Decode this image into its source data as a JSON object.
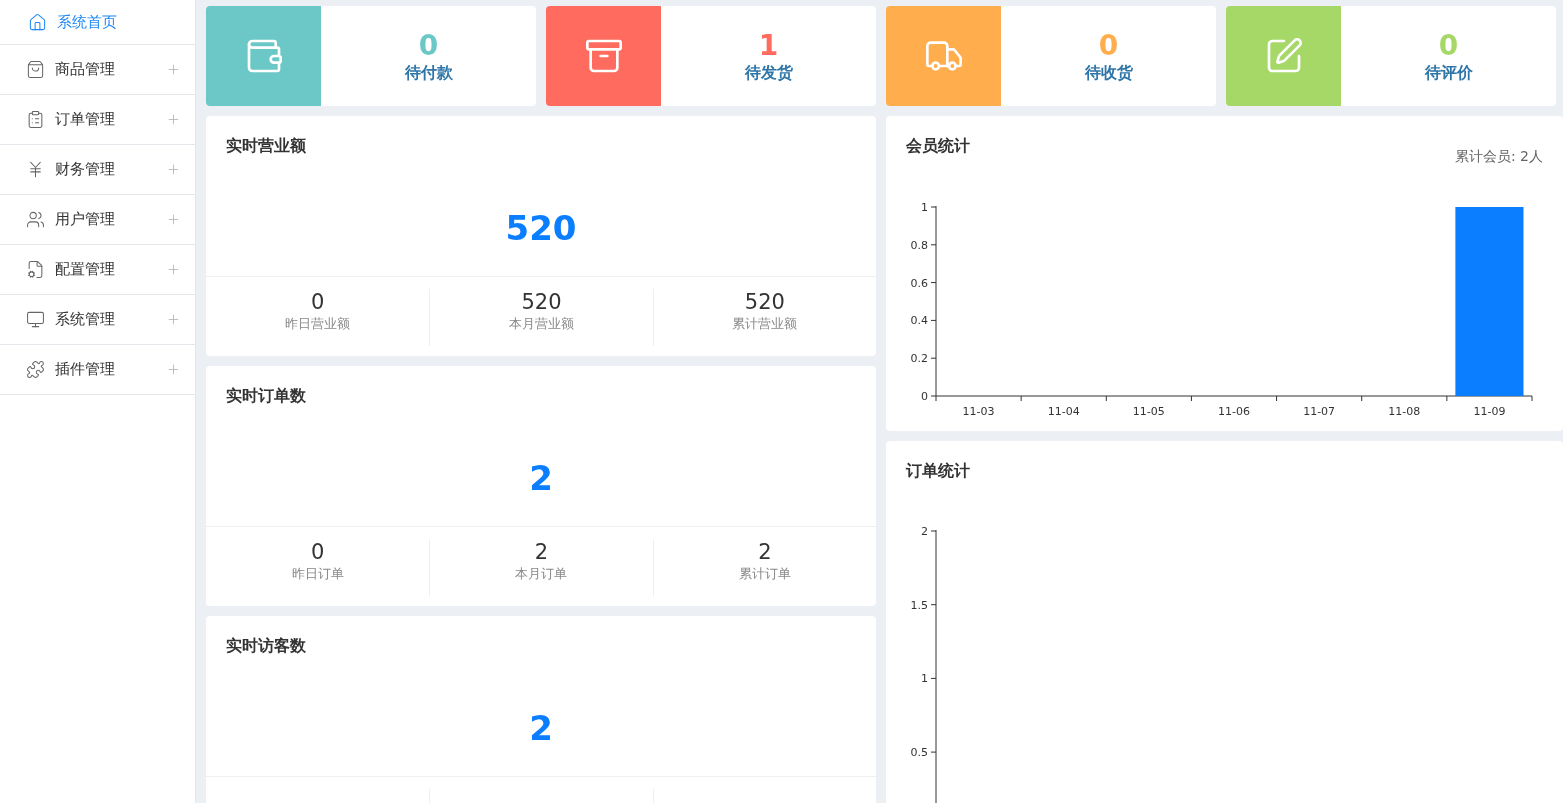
{
  "sidebar": {
    "items": [
      {
        "label": "系统首页",
        "kind": "link",
        "selected": true
      },
      {
        "label": "商品管理",
        "kind": "group",
        "selected": false,
        "expanded": false
      },
      {
        "label": "订单管理",
        "kind": "group",
        "selected": false,
        "expanded": false
      },
      {
        "label": "财务管理",
        "kind": "group",
        "selected": false,
        "expanded": false
      },
      {
        "label": "用户管理",
        "kind": "group",
        "selected": false,
        "expanded": false
      },
      {
        "label": "配置管理",
        "kind": "group",
        "selected": false,
        "expanded": false
      },
      {
        "label": "系统管理",
        "kind": "group",
        "selected": false,
        "expanded": false
      },
      {
        "label": "插件管理",
        "kind": "group",
        "selected": false,
        "expanded": false
      }
    ]
  },
  "status_cards": [
    {
      "value": "0",
      "label": "待付款",
      "kind": "wallet",
      "color": "#6bc8c6"
    },
    {
      "value": "1",
      "label": "待发货",
      "kind": "box",
      "color": "#ff6b5f"
    },
    {
      "value": "0",
      "label": "待收货",
      "kind": "truck",
      "color": "#ffad4d"
    },
    {
      "value": "0",
      "label": "待评价",
      "kind": "edit",
      "color": "#a6d867"
    }
  ],
  "realtime_cards": [
    {
      "title": "实时营业额",
      "value": "520",
      "stats": [
        {
          "value": "0",
          "label": "昨日营业额"
        },
        {
          "value": "520",
          "label": "本月营业额"
        },
        {
          "value": "520",
          "label": "累计营业额"
        }
      ]
    },
    {
      "title": "实时订单数",
      "value": "2",
      "stats": [
        {
          "value": "0",
          "label": "昨日订单"
        },
        {
          "value": "2",
          "label": "本月订单"
        },
        {
          "value": "2",
          "label": "累计订单"
        }
      ]
    },
    {
      "title": "实时访客数",
      "value": "2"
    }
  ],
  "member_stats": {
    "title": "会员统计",
    "total": "累计会员: 2人",
    "chart_data": {
      "type": "bar",
      "categories": [
        "11-03",
        "11-04",
        "11-05",
        "11-06",
        "11-07",
        "11-08",
        "11-09"
      ],
      "series": [
        {
          "color": "#0a7eff",
          "values": [
            0,
            0,
            0,
            0,
            0,
            0,
            1
          ]
        }
      ],
      "ylim": [
        0,
        1
      ],
      "yticks": [
        0,
        0.2,
        0.4,
        0.6,
        0.8,
        1
      ]
    }
  },
  "order_stats": {
    "title": "订单统计",
    "axis_labels": [
      "2",
      "1.5",
      "1",
      "0.5"
    ]
  }
}
